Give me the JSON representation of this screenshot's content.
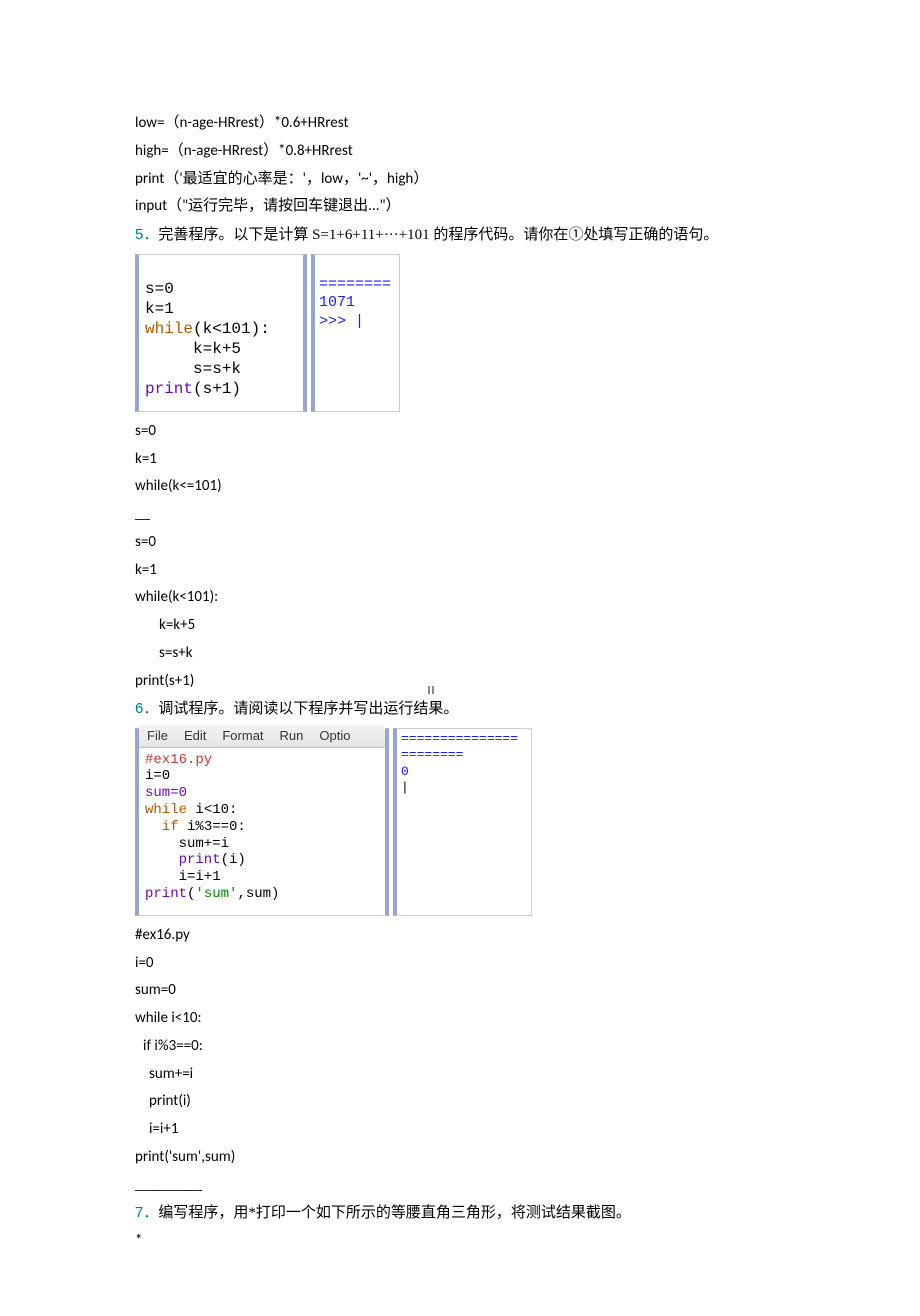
{
  "block1": {
    "l1": "low=（n-age-HRrest）*0.6+HRrest",
    "l2": "high=（n-age-HRrest）*0.8+HRrest",
    "l3": "print（'最适宜的心率是：'，low，'~'，high）",
    "l4": "input（\"运行完毕，请按回车键退出...\"）"
  },
  "q5": {
    "num": "5．",
    "text": "完善程序。以下是计算 S=1+6+11+···+101 的程序代码。请你在①处填写正确的语句。"
  },
  "shot1": {
    "code": {
      "l1a": "s=0",
      "l1b": "k=1",
      "l2a": "while",
      "l2b": "(k<101):",
      "l3": "     k=k+5",
      "l4": "     s=s+k",
      "l5a": "print",
      "l5b": "(s+1)"
    },
    "out": {
      "l1": "========",
      "l2": "1071",
      "l3": ">>> |"
    }
  },
  "ans5a": {
    "l1": "s=0",
    "l2": "k=1",
    "l3": "while(k<=101)",
    "l4": "__"
  },
  "ans5b": {
    "l1": "s=0",
    "l2": "k=1",
    "l3": "while(k<101):",
    "l4": "k=k+5",
    "l5": "s=s+k",
    "l6": "print(s+1)"
  },
  "q6": {
    "num": "6．",
    "text": "调试程序。请阅读以下程序并写出运行结果。"
  },
  "shot2": {
    "menu": {
      "file": "File",
      "edit": "Edit",
      "format": "Format",
      "run": "Run",
      "options": "Optio"
    },
    "code": {
      "l1": "#ex16.py",
      "l2": "i=0",
      "l3": "sum=0",
      "l4a": "while",
      "l4b": " i<10:",
      "l5a": "  if",
      "l5b": " i%3==0:",
      "l6": "    sum+=i",
      "l7a": "    print",
      "l7b": "(i)",
      "l8": "    i=i+1",
      "l9a": "print",
      "l9b": "(",
      "l9c": "'sum'",
      "l9d": ",sum)"
    },
    "out": {
      "l1": "===============",
      "l2": "========",
      "l3": "0",
      "l4": "|"
    }
  },
  "ans6": {
    "l1": "#ex16.py",
    "l2": "i=0",
    "l3": "sum=0",
    "l4": "while i<10:",
    "l5": "if i%3==0:",
    "l6": "sum+=i",
    "l7": "print(i)",
    "l8": "i=i+1",
    "l9": "print('sum',sum)",
    "l10": "_________"
  },
  "q7": {
    "num": "7．",
    "text": "编写程序，用*打印一个如下所示的等腰直角三角形，将测试结果截图。",
    "star": "*"
  }
}
